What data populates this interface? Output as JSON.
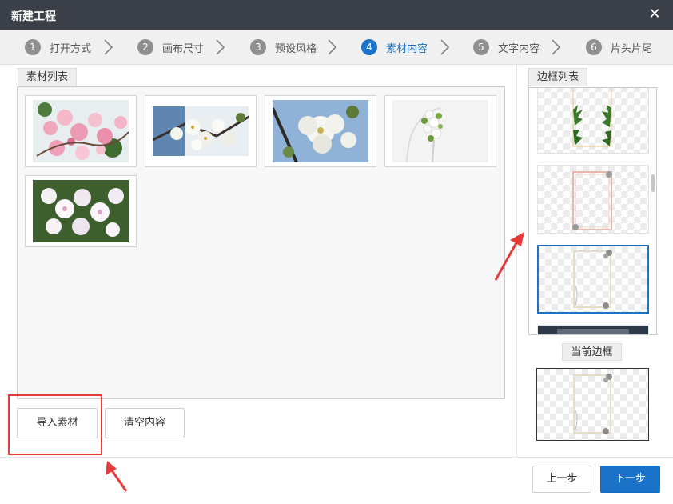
{
  "window": {
    "title": "新建工程",
    "close_glyph": "✕"
  },
  "steps": [
    {
      "num": "1",
      "label": "打开方式",
      "active": false
    },
    {
      "num": "2",
      "label": "画布尺寸",
      "active": false
    },
    {
      "num": "3",
      "label": "预设风格",
      "active": false
    },
    {
      "num": "4",
      "label": "素材内容",
      "active": true
    },
    {
      "num": "5",
      "label": "文字内容",
      "active": false
    },
    {
      "num": "6",
      "label": "片头片尾",
      "active": false
    }
  ],
  "material": {
    "label": "素材列表",
    "items": [
      {
        "icon": "pink-blossom-photo"
      },
      {
        "icon": "white-blossom-branch-photo"
      },
      {
        "icon": "white-flower-closeup-photo"
      },
      {
        "icon": "white-bouquet-photo"
      },
      {
        "icon": "white-rhododendron-photo"
      }
    ]
  },
  "buttons": {
    "import": "导入素材",
    "clear": "清空内容",
    "prev": "上一步",
    "next": "下一步"
  },
  "frames": {
    "label": "边框列表",
    "items": [
      {
        "icon": "green-leaf-frame",
        "selected": false
      },
      {
        "icon": "pink-floral-frame",
        "selected": false
      },
      {
        "icon": "beige-floral-frame",
        "selected": true
      },
      {
        "icon": "dark-frame",
        "selected": false
      }
    ]
  },
  "current_frame": {
    "label": "当前边框",
    "icon": "beige-floral-frame"
  },
  "colors": {
    "accent": "#1a73c9",
    "highlight": "#e83a3a",
    "titlebar": "#3b4048"
  }
}
